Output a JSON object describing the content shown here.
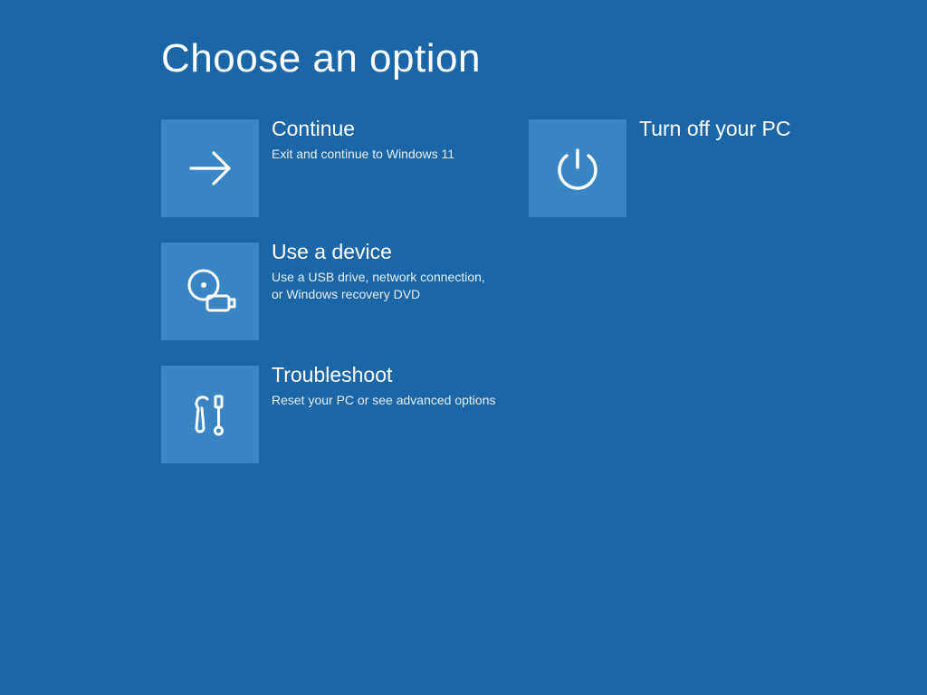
{
  "title": "Choose an option",
  "left": [
    {
      "title": "Continue",
      "desc": "Exit and continue to Windows 11"
    },
    {
      "title": "Use a device",
      "desc": "Use a USB drive, network connection, or Windows recovery DVD"
    },
    {
      "title": "Troubleshoot",
      "desc": "Reset your PC or see advanced options"
    }
  ],
  "right": [
    {
      "title": "Turn off your PC",
      "desc": ""
    }
  ]
}
